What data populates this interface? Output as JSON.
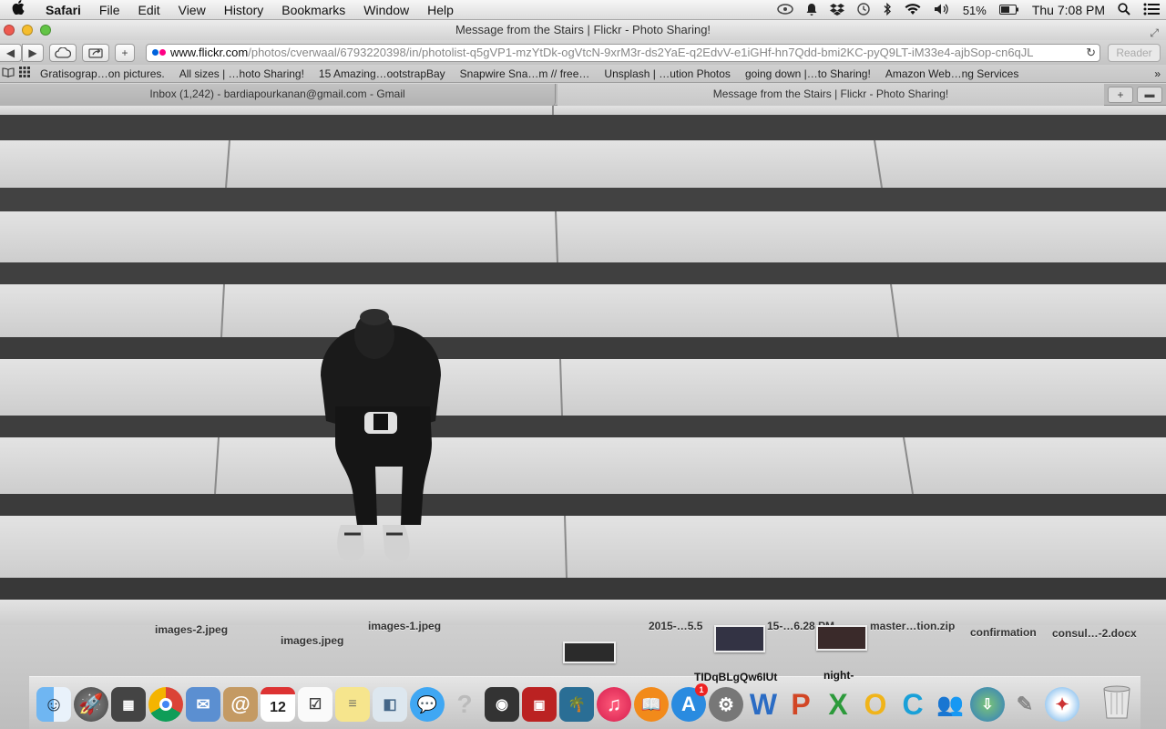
{
  "menubar": {
    "app": "Safari",
    "items": [
      "File",
      "Edit",
      "View",
      "History",
      "Bookmarks",
      "Window",
      "Help"
    ],
    "battery": "51%",
    "clock": "Thu 7:08 PM"
  },
  "window": {
    "title": "Message from the Stairs | Flickr - Photo Sharing!"
  },
  "toolbar": {
    "url_host": "www.flickr.com",
    "url_path": "/photos/cverwaal/6793220398/in/photolist-q5gVP1-mzYtDk-ogVtcN-9xrM3r-ds2YaE-q2EdvV-e1iGHf-hn7Qdd-bmi2KC-pyQ9LT-iM33e4-ajbSop-cn6qJL",
    "reader_label": "Reader",
    "flickr_colors": [
      "#0063dc",
      "#ff0084"
    ]
  },
  "bookmarks": [
    "Gratisograp…on pictures.",
    "All sizes | …hoto Sharing!",
    "15 Amazing…ootstrapBay",
    "Snapwire Sna…m // free…",
    "Unsplash | …ution Photos",
    "going down |…to Sharing!",
    "Amazon Web…ng Services"
  ],
  "tabs": [
    {
      "label": "Inbox (1,242) - bardiapourkanan@gmail.com - Gmail",
      "active": false
    },
    {
      "label": "Message from the Stairs | Flickr - Photo Sharing!",
      "active": true
    }
  ],
  "desktop": {
    "files": [
      "images-2.jpeg",
      "images.jpeg",
      "images-1.jpeg",
      "confirmation",
      "consul…-2.docx",
      "2015-…5.5",
      "15-…6.28 PM",
      "master…tion.zip"
    ],
    "dock_labels": [
      "TIDqBLgQw6IUt",
      "night-"
    ],
    "dock_apps": [
      "finder-icon",
      "launchpad-icon",
      "photo-booth-icon",
      "chrome-icon",
      "mail-icon",
      "contacts-icon",
      "calendar-icon",
      "reminders-icon",
      "notes-icon",
      "preview-icon",
      "messages-icon",
      "help-icon",
      "facetime-icon",
      "photo-icon",
      "iphoto-icon",
      "itunes-icon",
      "ibooks-icon",
      "app-store-icon",
      "system-preferences-icon",
      "word-icon",
      "powerpoint-icon",
      "excel-icon",
      "outlook-icon",
      "c-icon",
      "messenger-icon",
      "network-icon",
      "remote-icon",
      "safari-icon"
    ],
    "calendar_day": "12",
    "app_store_badge": "1"
  }
}
